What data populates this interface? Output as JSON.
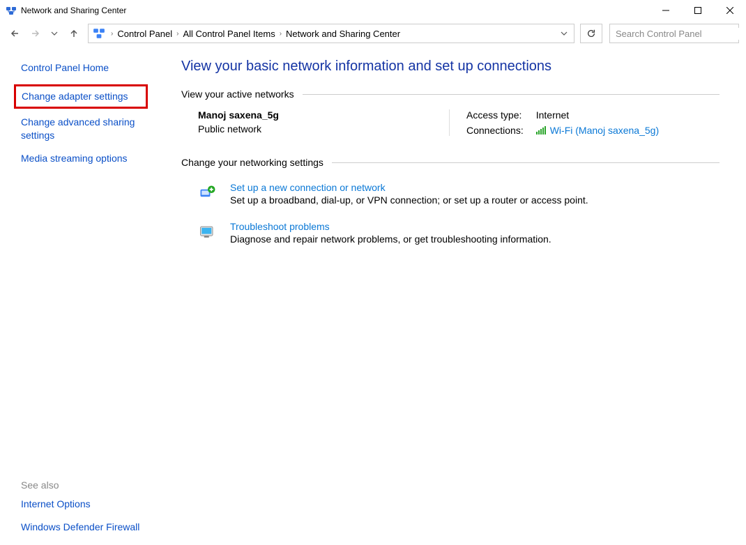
{
  "window": {
    "title": "Network and Sharing Center"
  },
  "breadcrumbs": {
    "item0": "Control Panel",
    "item1": "All Control Panel Items",
    "item2": "Network and Sharing Center"
  },
  "search": {
    "placeholder": "Search Control Panel"
  },
  "sidebar": {
    "home": "Control Panel Home",
    "adapter": "Change adapter settings",
    "advanced": "Change advanced sharing settings",
    "media": "Media streaming options",
    "see_also_label": "See also",
    "internet_options": "Internet Options",
    "firewall": "Windows Defender Firewall"
  },
  "main": {
    "heading": "View your basic network information and set up connections",
    "active_header": "View your active networks",
    "network_name": "Manoj saxena_5g",
    "network_type": "Public network",
    "access_label": "Access type:",
    "access_value": "Internet",
    "conn_label": "Connections:",
    "conn_value": "Wi-Fi (Manoj saxena_5g)",
    "change_header": "Change your networking settings",
    "action1_title": "Set up a new connection or network",
    "action1_desc": "Set up a broadband, dial-up, or VPN connection; or set up a router or access point.",
    "action2_title": "Troubleshoot problems",
    "action2_desc": "Diagnose and repair network problems, or get troubleshooting information."
  }
}
